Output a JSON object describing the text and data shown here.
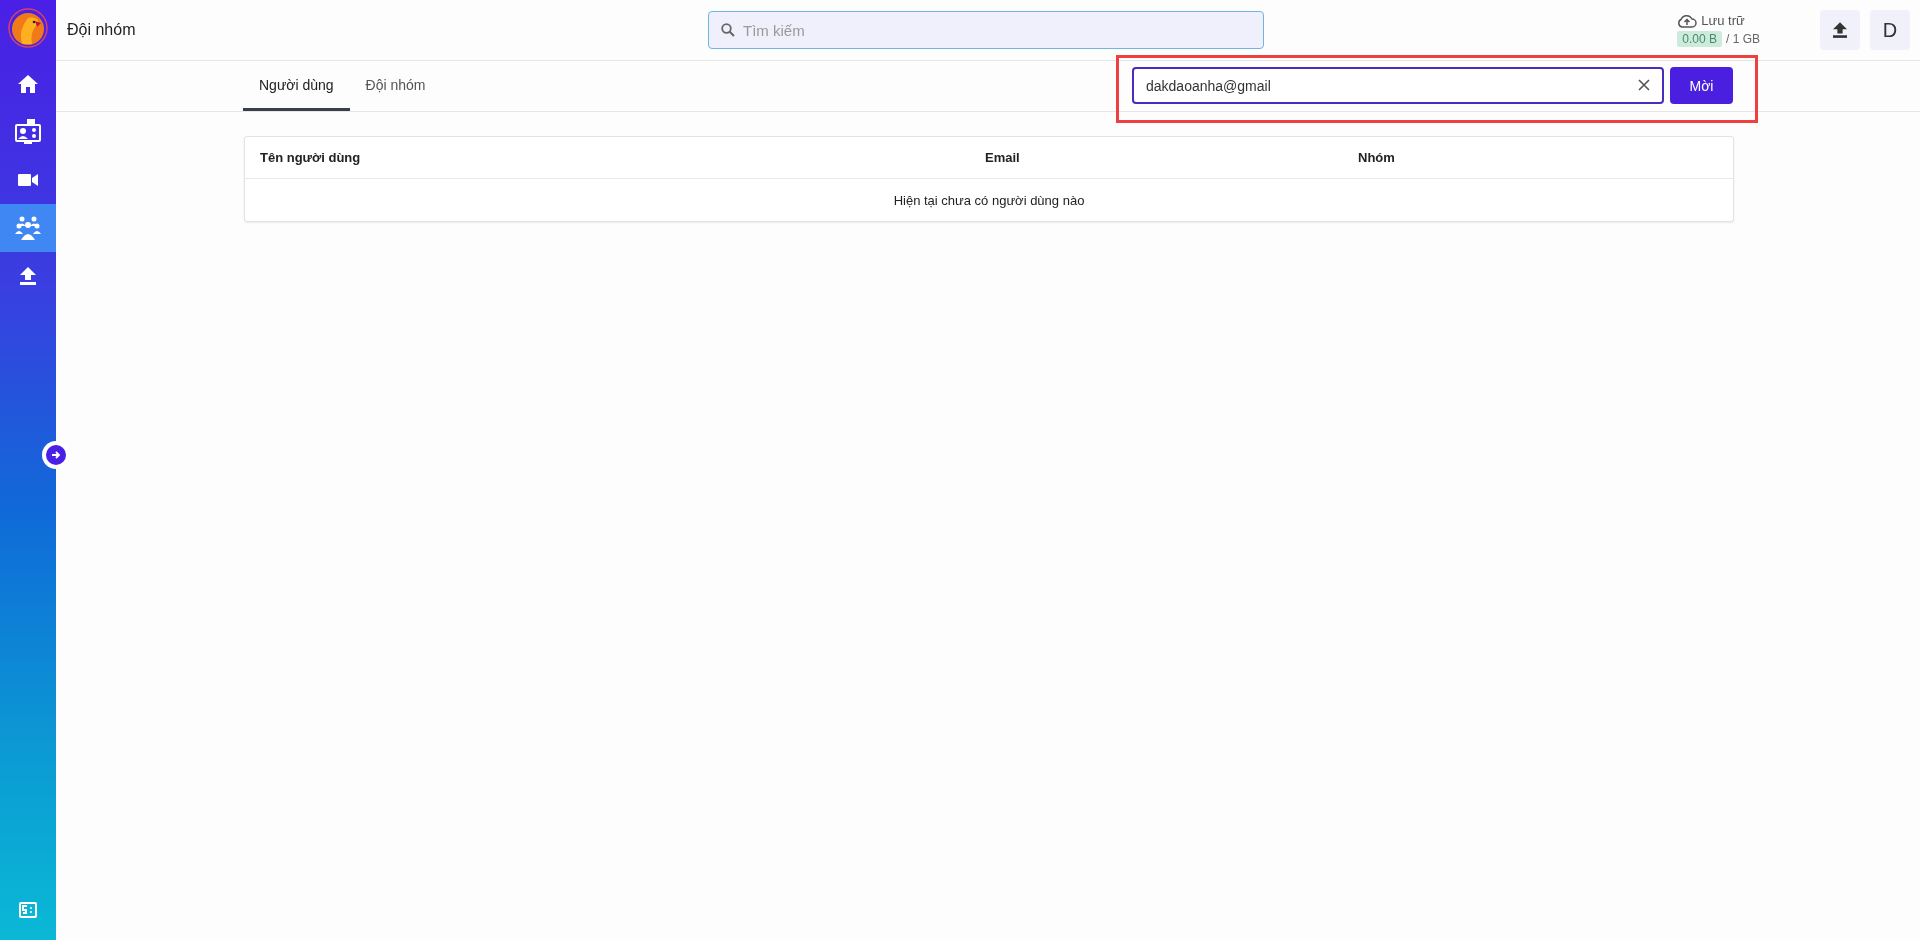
{
  "sidebar": {
    "items": [
      {
        "kind": "home",
        "selected": false
      },
      {
        "kind": "meetings",
        "selected": false
      },
      {
        "kind": "video",
        "selected": false
      },
      {
        "kind": "team",
        "selected": true
      },
      {
        "kind": "upload",
        "selected": false
      }
    ],
    "bottom_items": [
      {
        "kind": "billing",
        "selected": false
      }
    ]
  },
  "header": {
    "title": "Đội nhóm",
    "search": {
      "placeholder": "Tìm kiếm"
    },
    "storage": {
      "label": "Lưu trữ",
      "used": "0.00 B",
      "total": "/ 1 GB"
    },
    "avatar": "D"
  },
  "tabs": [
    {
      "label": "Người dùng",
      "selected": true
    },
    {
      "label": "Đội nhóm",
      "selected": false
    }
  ],
  "invite": {
    "value": "dakdaoanha@gmail",
    "button": "Mời"
  },
  "table": {
    "columns": [
      "Tên người dùng",
      "Email",
      "Nhóm"
    ],
    "empty_message": "Hiện tại chưa có người dùng nào"
  }
}
